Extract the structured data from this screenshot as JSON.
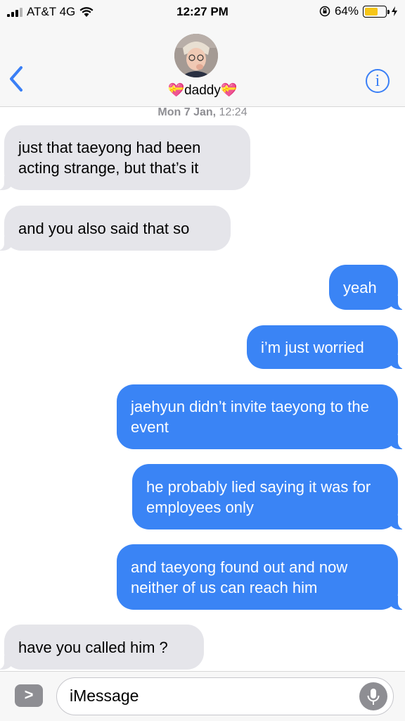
{
  "status_bar": {
    "carrier": "AT&T 4G",
    "time": "12:27 PM",
    "battery_percent": "64%",
    "battery_level": 0.64,
    "icons": [
      "signal-icon",
      "wifi-icon",
      "rotation-lock-icon",
      "battery-icon",
      "charging-icon"
    ]
  },
  "header": {
    "contact_name": "daddy",
    "contact_emoji": "💝",
    "info_label": "i"
  },
  "timestamp": {
    "day": "Mon 7 Jan,",
    "time": "12:24"
  },
  "messages": [
    {
      "from": "them",
      "text": "just that taeyong had been acting strange, but that’s it"
    },
    {
      "from": "them",
      "text": "and you also said that so"
    },
    {
      "from": "me",
      "text": "yeah"
    },
    {
      "from": "me",
      "text": "i’m just worried"
    },
    {
      "from": "me",
      "text": "jaehyun didn’t invite taeyong to the event"
    },
    {
      "from": "me",
      "text": "he probably lied saying it was for employees only"
    },
    {
      "from": "me",
      "text": "and taeyong found out and now neither of us can reach him"
    },
    {
      "from": "them",
      "text": "have you called him ?"
    }
  ],
  "composer": {
    "placeholder": "iMessage",
    "apps_label": ">"
  },
  "colors": {
    "outgoing": "#3a84f5",
    "incoming": "#e5e5ea",
    "accent": "#3a7ff6",
    "battery": "#f5c518"
  }
}
